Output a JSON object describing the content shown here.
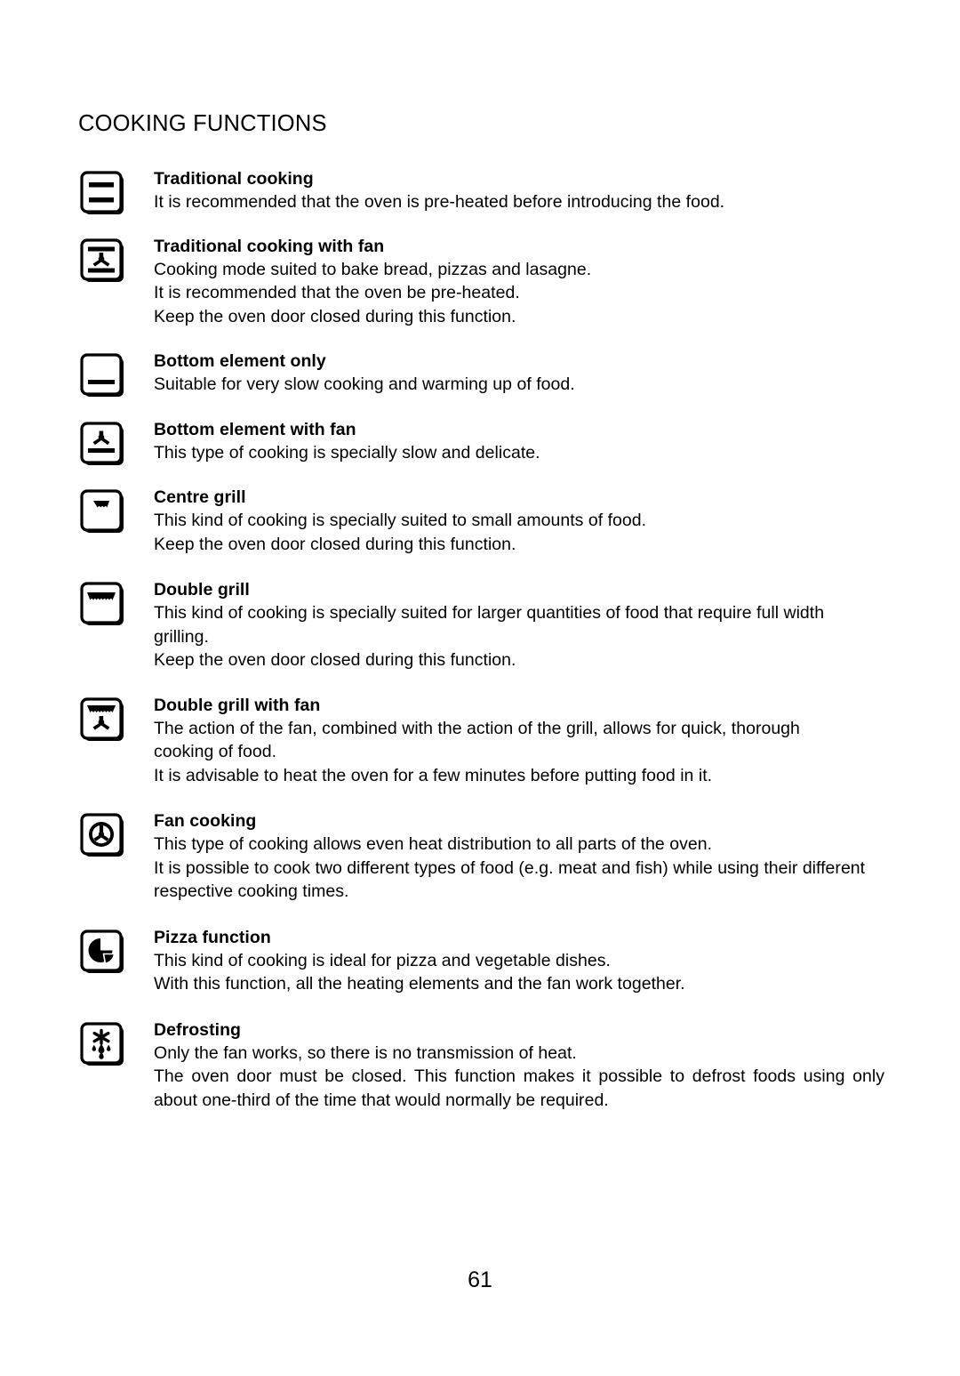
{
  "document": {
    "title": "COOKING FUNCTIONS",
    "page_number": "61"
  },
  "functions": [
    {
      "icon": "oven-top-and-bottom-element-icon",
      "title": "Traditional cooking",
      "lines": [
        "It is recommended that the oven is pre-heated before introducing the food."
      ]
    },
    {
      "icon": "oven-top-and-bottom-element-with-fan-icon",
      "title": "Traditional cooking with fan",
      "lines": [
        "Cooking mode suited to bake bread, pizzas and lasagne.",
        "It is recommended that the oven be pre-heated.",
        "Keep the oven door closed during this function."
      ]
    },
    {
      "icon": "oven-bottom-element-icon",
      "title": "Bottom element only",
      "lines": [
        "Suitable for very slow cooking and warming up of food."
      ]
    },
    {
      "icon": "oven-bottom-element-with-fan-icon",
      "title": "Bottom element with fan",
      "lines": [
        "This type of cooking is specially slow and delicate."
      ]
    },
    {
      "icon": "oven-centre-grill-icon",
      "title": "Centre grill",
      "lines": [
        "This kind of cooking is specially suited to small amounts of food.",
        "Keep the oven door closed during this function."
      ]
    },
    {
      "icon": "oven-double-grill-icon",
      "title": "Double grill",
      "lines": [
        "This kind of cooking is specially suited for larger quantities of food that require full width grilling.",
        "Keep the oven door closed during this function."
      ]
    },
    {
      "icon": "oven-double-grill-with-fan-icon",
      "title": "Double grill with fan",
      "lines": [
        "The action of the fan, combined with the action of the grill, allows for quick, thorough cooking of food.",
        "It is advisable to heat the oven for a few minutes before putting food in it."
      ]
    },
    {
      "icon": "oven-fan-cooking-icon",
      "title": "Fan cooking",
      "lines": [
        "This type of cooking allows even heat distribution to all parts of the oven.",
        "It is possible to cook two different types of food (e.g. meat and fish) while using their different respective cooking times."
      ]
    },
    {
      "icon": "oven-pizza-function-icon",
      "title": "Pizza function",
      "lines": [
        "This kind of cooking is ideal for pizza and vegetable dishes.",
        "With this function, all the heating elements and the fan work together."
      ]
    },
    {
      "icon": "oven-defrosting-icon",
      "title": "Defrosting",
      "lines": [
        "Only the fan works, so there is no transmission of heat.",
        "The oven door must be closed. This function makes it possible to defrost foods using only about one-third of the time that would normally be required."
      ]
    }
  ]
}
